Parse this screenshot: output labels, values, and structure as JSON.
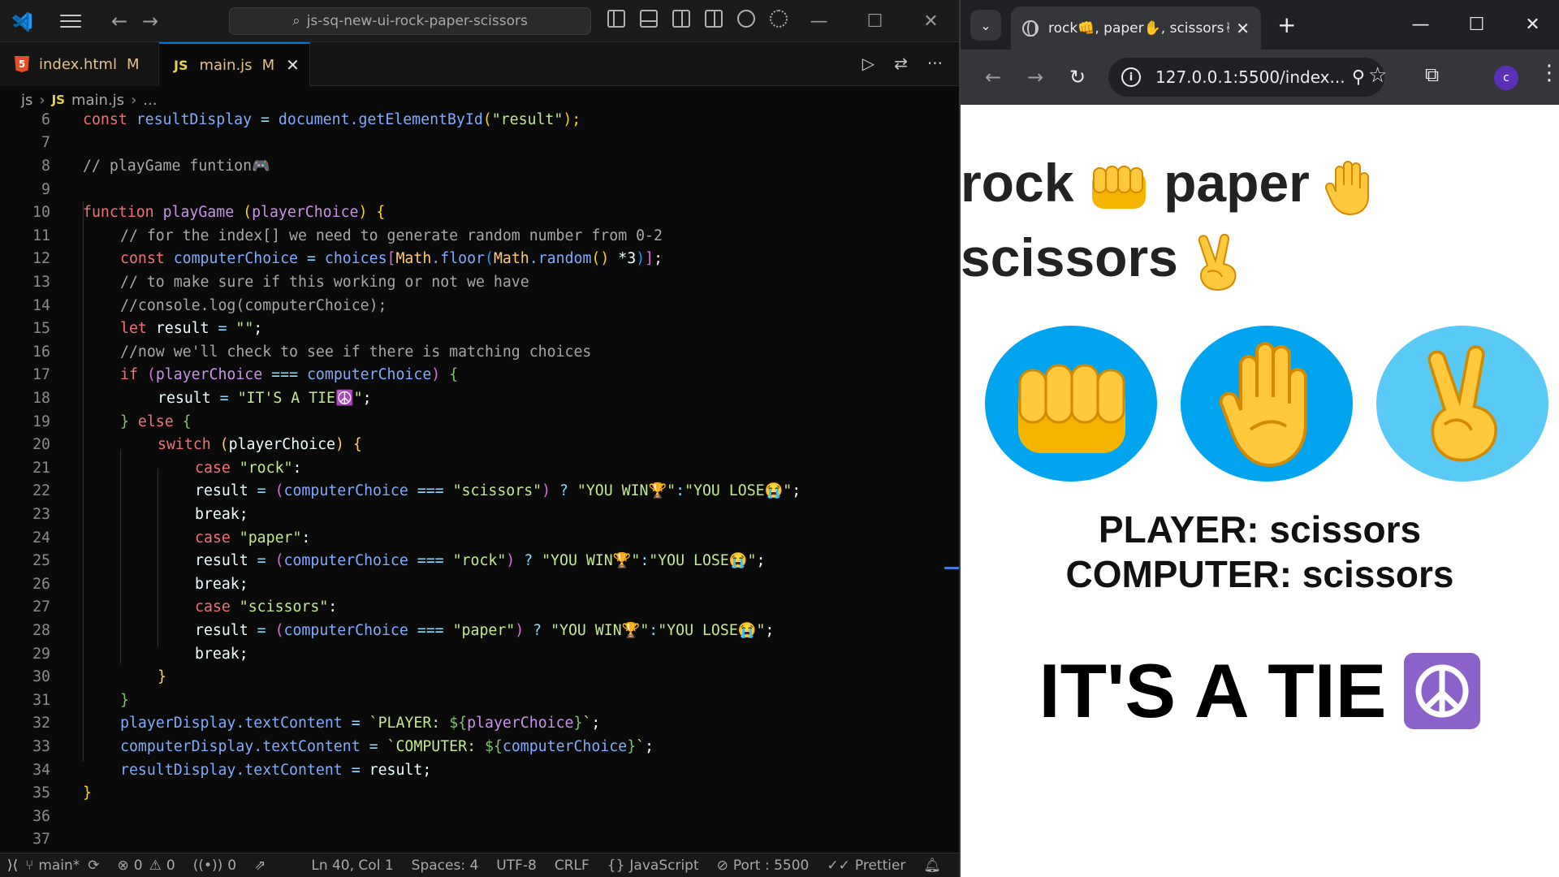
{
  "vscode": {
    "search_text": "js-sq-new-ui-rock-paper-scissors",
    "tabs": [
      {
        "icon": "5",
        "label": "index.html",
        "status": "M"
      },
      {
        "icon": "JS",
        "label": "main.js",
        "status": "M"
      }
    ],
    "breadcrumb": {
      "folder": "js",
      "file_icon": "JS",
      "file": "main.js",
      "more": "..."
    },
    "line_numbers": [
      "6",
      "7",
      "8",
      "9",
      "10",
      "11",
      "12",
      "13",
      "14",
      "15",
      "16",
      "17",
      "18",
      "19",
      "20",
      "21",
      "22",
      "23",
      "24",
      "25",
      "26",
      "27",
      "28",
      "29",
      "30",
      "31",
      "32",
      "33",
      "34",
      "35",
      "36",
      "37"
    ],
    "status": {
      "branch": "main*",
      "errors": "0",
      "warnings": "0",
      "ports_count": "0",
      "position": "Ln 40, Col 1",
      "spaces": "Spaces: 4",
      "encoding": "UTF-8",
      "eol": "CRLF",
      "language": "JavaScript",
      "port": "Port : 5500",
      "formatter": "Prettier"
    }
  },
  "code": {
    "l6": {
      "a": "const",
      "b": "resultDisplay",
      "c": "=",
      "d": "document",
      "e": ".getElementById",
      "f": "(",
      "g": "\"result\"",
      "h": ");"
    },
    "l8": "// playGame funtion",
    "l10": {
      "a": "function",
      "b": "playGame",
      "c": "(",
      "d": "playerChoice",
      "e": ")",
      "f": "{"
    },
    "l11": "// for the index[] we need to generate random number from 0-2",
    "l12": {
      "a": "const",
      "b": "computerChoice",
      "c": "=",
      "d": "choices",
      "e": "[",
      "f": "Math",
      "g": ".floor",
      "h": "(",
      "i": "Math",
      "j": ".random",
      "k": "()",
      "l": "*3",
      "m": ")",
      "n": "]",
      "o": ";"
    },
    "l13": "// to make sure if this working or not we have",
    "l14": "//console.log(computerChoice);",
    "l15": {
      "a": "let",
      "b": "result",
      "c": "=",
      "d": "\"\"",
      "e": ";"
    },
    "l16": "//now we'll check to see if there is matching choices",
    "l17": {
      "a": "if",
      "b": "(",
      "c": "playerChoice",
      "d": "===",
      "e": "computerChoice",
      "f": ")",
      "g": "{"
    },
    "l18": {
      "a": "result",
      "b": "=",
      "c": "\"IT'S A TIE",
      "d": "\"",
      "e": ";"
    },
    "l19": {
      "a": "}",
      "b": "else",
      "c": "{"
    },
    "l20": {
      "a": "switch",
      "b": "(",
      "c": "playerChoice",
      "d": ")",
      "e": "{"
    },
    "l21": {
      "a": "case",
      "b": "\"rock\"",
      "c": ":"
    },
    "l22": {
      "a": "result",
      "b": "=",
      "c": "(",
      "d": "computerChoice",
      "e": "===",
      "f": "\"scissors\"",
      "g": ")",
      "h": "?",
      "i": "\"YOU WIN",
      "j": "\"",
      "k": ":",
      "l": "\"YOU LOSE",
      "m": "\"",
      "n": ";"
    },
    "l23": "break;",
    "l24": {
      "a": "case",
      "b": "\"paper\"",
      "c": ":"
    },
    "l25": {
      "a": "result",
      "b": "=",
      "c": "(",
      "d": "computerChoice",
      "e": "===",
      "f": "\"rock\"",
      "g": ")",
      "h": "?",
      "i": "\"YOU WIN",
      "j": "\"",
      "k": ":",
      "l": "\"YOU LOSE",
      "m": "\"",
      "n": ";"
    },
    "l26": "break;",
    "l27": {
      "a": "case",
      "b": "\"scissors\"",
      "c": ":"
    },
    "l28": {
      "a": "result",
      "b": "=",
      "c": "(",
      "d": "computerChoice",
      "e": "===",
      "f": "\"paper\"",
      "g": ")",
      "h": "?",
      "i": "\"YOU WIN",
      "j": "\"",
      "k": ":",
      "l": "\"YOU LOSE",
      "m": "\"",
      "n": ";"
    },
    "l29": "break;",
    "l30": "}",
    "l31": "}",
    "l32": {
      "a": "playerDisplay",
      "b": ".textContent",
      "c": "=",
      "d": "`PLAYER: ",
      "e": "${",
      "f": "playerChoice",
      "g": "}",
      "h": "`",
      "i": ";"
    },
    "l33": {
      "a": "computerDisplay",
      "b": ".textContent",
      "c": "=",
      "d": "`COMPUTER: ",
      "e": "${",
      "f": "computerChoice",
      "g": "}",
      "h": "`",
      "i": ";"
    },
    "l34": {
      "a": "resultDisplay",
      "b": ".textContent",
      "c": "=",
      "d": "result",
      "e": ";"
    },
    "l35": "}"
  },
  "chrome": {
    "tab_title": "rock👊, paper✋, scissors✌",
    "url": "127.0.0.1:5500/index...",
    "profile_initial": "c"
  },
  "page": {
    "title_rock": "rock",
    "title_paper": "paper",
    "title_scissors": "scissors",
    "player_text": "PLAYER: scissors",
    "computer_text": "COMPUTER: scissors",
    "result_text": "IT'S A TIE"
  }
}
